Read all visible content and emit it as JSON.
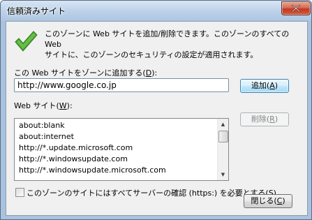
{
  "window": {
    "title": "信頼済みサイト"
  },
  "intro": {
    "line1": "このゾーンに Web サイトを追加/削除できます。このゾーンのすべての Web",
    "line2": "サイトに、このゾーンのセキュリティの設定が適用されます。"
  },
  "add_site": {
    "label": "この Web サイトをゾーンに追加する(",
    "label_key": "D",
    "label_end": "):",
    "value": "http://www.google.co.jp",
    "button": "追加(",
    "button_key": "A",
    "button_end": ")"
  },
  "websites": {
    "label": "Web サイト(",
    "label_key": "W",
    "label_end": "):",
    "items": [
      "about:blank",
      "about:internet",
      "http://*.update.microsoft.com",
      "http://*.windowsupdate.com",
      "http://*.windowsupdate.microsoft.com"
    ],
    "remove_button": "削除(",
    "remove_key": "R",
    "remove_end": ")"
  },
  "https_check": {
    "label": "このゾーンのサイトにはすべてサーバーの確認 (https:) を必要とする(",
    "key": "S",
    "label_end": ")",
    "checked": false
  },
  "footer": {
    "close_button": "閉じる(",
    "close_key": "C",
    "close_end": ")"
  },
  "colors": {
    "check_icon": "#4aa832",
    "title_bg": "#bcd3ea",
    "close_button": "#c0391f",
    "default_button_border": "#3c7fb1"
  },
  "icons": {
    "status": "green-checkmark-icon",
    "window_close": "close-x-icon",
    "scroll_up": "triangle-up-icon",
    "scroll_down": "triangle-down-icon"
  }
}
